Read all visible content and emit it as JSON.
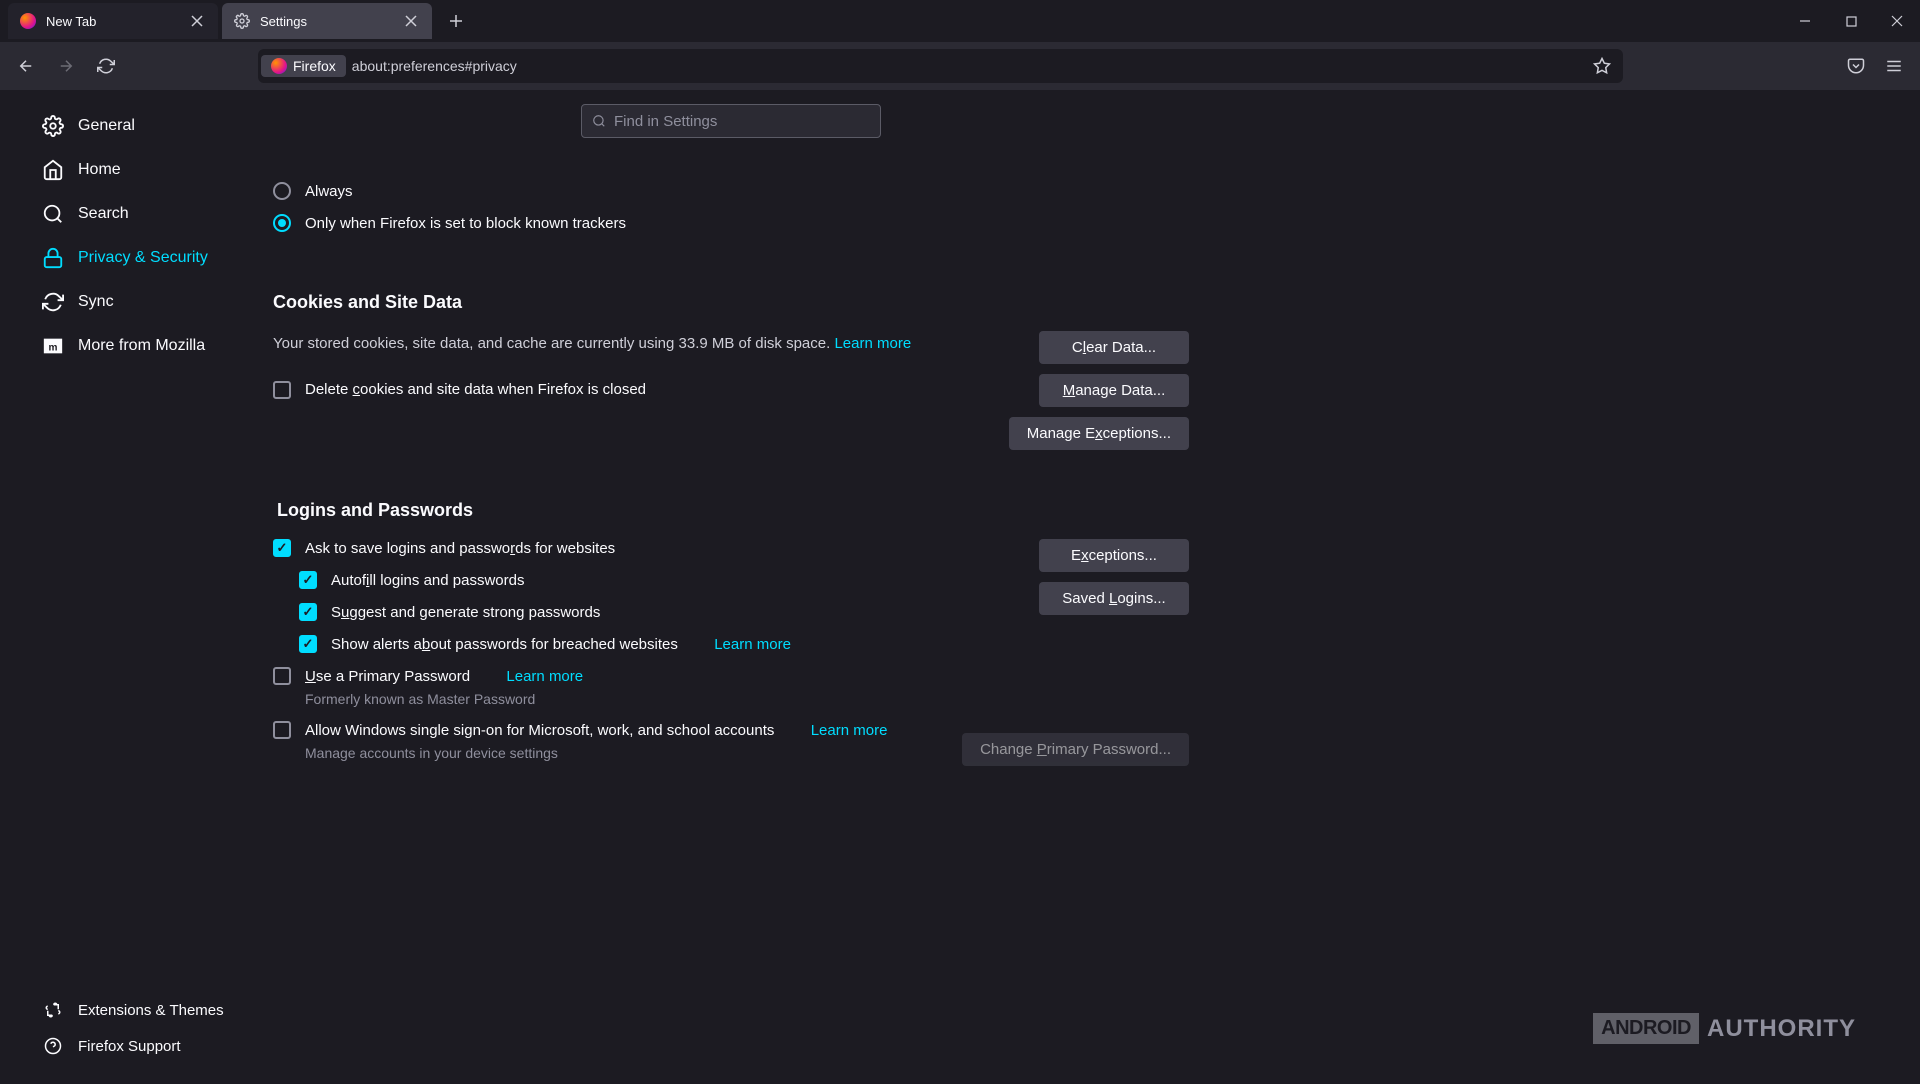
{
  "tabs": {
    "items": [
      {
        "title": "New Tab",
        "active": false
      },
      {
        "title": "Settings",
        "active": true
      }
    ]
  },
  "urlbar": {
    "identity_label": "Firefox",
    "url": "about:preferences#privacy"
  },
  "search": {
    "placeholder": "Find in Settings"
  },
  "sidebar": {
    "items": [
      {
        "label": "General",
        "icon": "gear"
      },
      {
        "label": "Home",
        "icon": "home"
      },
      {
        "label": "Search",
        "icon": "search"
      },
      {
        "label": "Privacy & Security",
        "icon": "lock",
        "active": true
      },
      {
        "label": "Sync",
        "icon": "sync"
      },
      {
        "label": "More from Mozilla",
        "icon": "mozilla"
      }
    ],
    "bottom": [
      {
        "label": "Extensions & Themes"
      },
      {
        "label": "Firefox Support"
      }
    ]
  },
  "dnt": {
    "opt_always": "Always",
    "opt_only": "Only when Firefox is set to block known trackers"
  },
  "cookies": {
    "heading": "Cookies and Site Data",
    "desc_pre": "Your stored cookies, site data, and cache are currently using ",
    "size": "33.9 MB",
    "desc_post": " of disk space.   ",
    "learn_more": "Learn more",
    "delete_label_pre": "Delete ",
    "delete_label_u": "c",
    "delete_label_post": "ookies and site data when Firefox is closed",
    "btn_clear_pre": "C",
    "btn_clear_u": "l",
    "btn_clear_post": "ear Data...",
    "btn_manage_pre": "",
    "btn_manage_u": "M",
    "btn_manage_post": "anage Data...",
    "btn_exc_pre": "Manage E",
    "btn_exc_u": "x",
    "btn_exc_post": "ceptions..."
  },
  "logins": {
    "heading": "Logins and Passwords",
    "ask_pre": "Ask to save logins and passwo",
    "ask_u": "r",
    "ask_post": "ds for websites",
    "autofill_pre": "Autof",
    "autofill_u": "i",
    "autofill_post": "ll logins and passwords",
    "suggest_pre": "S",
    "suggest_u": "u",
    "suggest_post": "ggest and generate strong passwords",
    "alerts_pre": "Show alerts a",
    "alerts_u": "b",
    "alerts_post": "out passwords for breached websites",
    "alerts_learn": "Learn more",
    "primary_pre": "",
    "primary_u": "U",
    "primary_post": "se a Primary Password",
    "primary_learn": "Learn more",
    "primary_sub": "Formerly known as Master Password",
    "sso": "Allow Windows single sign-on for Microsoft, work, and school accounts",
    "sso_learn": "Learn more",
    "sso_sub": "Manage accounts in your device settings",
    "btn_exc_pre": "E",
    "btn_exc_u": "x",
    "btn_exc_post": "ceptions...",
    "btn_saved_pre": "Saved ",
    "btn_saved_u": "L",
    "btn_saved_post": "ogins...",
    "btn_change_pre": "Change ",
    "btn_change_u": "P",
    "btn_change_post": "rimary Password..."
  },
  "watermark": {
    "box": "ANDROID",
    "text": "AUTHORITY"
  }
}
